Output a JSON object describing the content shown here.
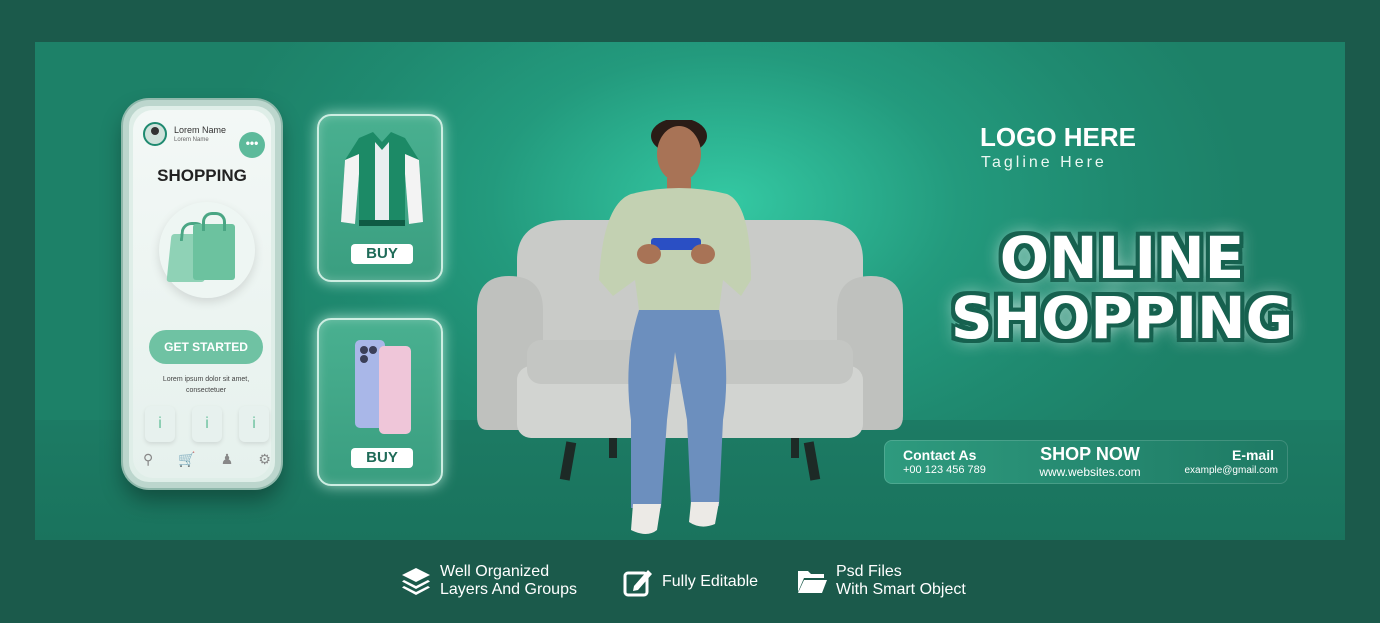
{
  "colors": {
    "background": "#1b5a4b",
    "banner": "#1f8a70",
    "accent": "#16614f"
  },
  "phone": {
    "user_name": "Lorem Name",
    "user_sub": "Lorem Name",
    "title": "SHOPPING",
    "cta": "GET STARTED",
    "body_line1": "Lorem ipsum dolor sit amet,",
    "body_line2": "consectetuer",
    "tiles": [
      "i",
      "i",
      "i"
    ],
    "nav_icons": [
      "search-icon",
      "cart-icon",
      "user-icon",
      "gear-icon"
    ]
  },
  "cards": [
    {
      "product": "jacket",
      "button": "BUY"
    },
    {
      "product": "smartphones",
      "button": "BUY"
    }
  ],
  "logo": {
    "name": "LOGO HERE",
    "tagline": "Tagline Here"
  },
  "headline": {
    "line1": "ONLINE",
    "line2": "SHOPPING"
  },
  "contact": {
    "label": "Contact As",
    "phone": "+00 123 456 789",
    "cta": "SHOP NOW",
    "website": "www.websites.com",
    "email_label": "E-mail",
    "email": "example@gmail.com"
  },
  "features": [
    {
      "icon": "layers-icon",
      "line1": "Well Organized",
      "line2": "Layers And Groups"
    },
    {
      "icon": "edit-icon",
      "line1": "Fully Editable"
    },
    {
      "icon": "folder-icon",
      "line1": "Psd Files",
      "line2": "With Smart Object"
    }
  ]
}
